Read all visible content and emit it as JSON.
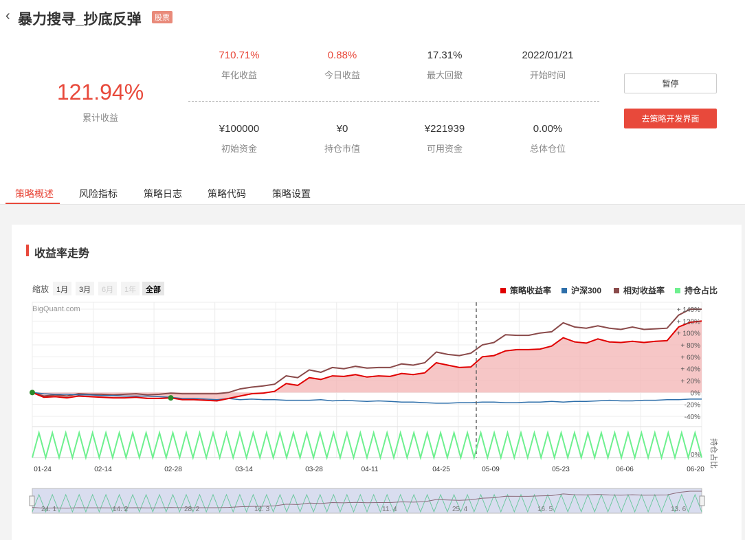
{
  "header": {
    "back_icon": "chevron-left-icon",
    "back_glyph": "‹",
    "title": "暴力搜寻_抄底反弹",
    "badge": "股票"
  },
  "summary": {
    "cumulative_value": "121.94%",
    "cumulative_label": "累计收益",
    "metrics": [
      {
        "value": "710.71%",
        "label": "年化收益",
        "color": "#e8493b"
      },
      {
        "value": "0.88%",
        "label": "今日收益",
        "color": "#e8493b"
      },
      {
        "value": "17.31%",
        "label": "最大回撤"
      },
      {
        "value": "2022/01/21",
        "label": "开始时间"
      },
      {
        "value": "¥100000",
        "label": "初始资金"
      },
      {
        "value": "¥0",
        "label": "持仓市值"
      },
      {
        "value": "¥221939",
        "label": "可用资金"
      },
      {
        "value": "0.00%",
        "label": "总体仓位"
      }
    ]
  },
  "actions": {
    "pause": "暂停",
    "dev": "去策略开发界面"
  },
  "tabs": [
    "策略概述",
    "风险指标",
    "策略日志",
    "策略代码",
    "策略设置"
  ],
  "section_title": "收益率走势",
  "zoom": {
    "label": "缩放",
    "options": [
      "1月",
      "3月",
      "6月",
      "1年",
      "全部"
    ],
    "disabled": [
      2,
      3
    ],
    "selected": 4
  },
  "legend": [
    {
      "label": "策略收益率",
      "color": "#e00000"
    },
    {
      "label": "沪深300",
      "color": "#2e6faa"
    },
    {
      "label": "相对收益率",
      "color": "#8a4a4a"
    },
    {
      "label": "持仓占比",
      "color": "#6ef08f"
    }
  ],
  "chart_data": {
    "type": "line",
    "watermark": "BigQuant.com",
    "x_ticks": [
      "01-24",
      "02-14",
      "02-28",
      "03-14",
      "03-28",
      "04-11",
      "04-25",
      "05-09",
      "05-23",
      "06-06",
      "06-20"
    ],
    "y_ticks": [
      "+ 140%",
      "+ 120%",
      "+ 100%",
      "+ 80%",
      "+ 60%",
      "+ 40%",
      "+ 20%",
      "0%",
      "-20%",
      "-40%"
    ],
    "ylim": [
      -40,
      140
    ],
    "position_axis_label": "持仓占比",
    "position_axis_tick": "0%",
    "navigator_labels": [
      "24. 1",
      "14. 2",
      "28. 2",
      "14. 3",
      "11. 4",
      "25. 4",
      "16. 5",
      "13. 6"
    ],
    "series": [
      {
        "name": "策略收益率",
        "color": "#e00000",
        "values": [
          0,
          -8,
          -7,
          -9,
          -6,
          -7,
          -8,
          -9,
          -9,
          -8,
          -10,
          -10,
          -9,
          -12,
          -12,
          -13,
          -14,
          -10,
          -6,
          -2,
          -1,
          2,
          15,
          12,
          25,
          22,
          28,
          27,
          30,
          26,
          28,
          27,
          32,
          30,
          33,
          50,
          46,
          42,
          43,
          60,
          62,
          70,
          72,
          72,
          73,
          78,
          92,
          85,
          83,
          90,
          85,
          84,
          86,
          84,
          86,
          87,
          110,
          118,
          120
        ],
        "markers": [
          0,
          12
        ]
      },
      {
        "name": "沪深300",
        "color": "#2e6faa",
        "values": [
          0,
          -2,
          -3,
          -3,
          -4,
          -4,
          -5,
          -5,
          -6,
          -6,
          -6,
          -7,
          -8,
          -10,
          -10,
          -11,
          -12,
          -10,
          -12,
          -11,
          -12,
          -12,
          -13,
          -13,
          -13,
          -12,
          -14,
          -13,
          -14,
          -15,
          -14,
          -15,
          -16,
          -16,
          -17,
          -18,
          -18,
          -17,
          -17,
          -16,
          -16,
          -17,
          -17,
          -16,
          -16,
          -15,
          -16,
          -15,
          -15,
          -14,
          -13,
          -14,
          -14,
          -13,
          -13,
          -12,
          -12,
          -11,
          -11
        ]
      },
      {
        "name": "相对收益率",
        "color": "#8a4a4a",
        "values": [
          0,
          -6,
          -4,
          -6,
          -2,
          -3,
          -3,
          -4,
          -3,
          -2,
          -4,
          -3,
          -1,
          -2,
          -2,
          -2,
          -2,
          0,
          6,
          9,
          11,
          14,
          28,
          25,
          38,
          34,
          42,
          40,
          44,
          41,
          42,
          42,
          48,
          46,
          50,
          68,
          64,
          62,
          66,
          80,
          84,
          97,
          96,
          96,
          100,
          102,
          117,
          110,
          108,
          112,
          108,
          106,
          110,
          106,
          107,
          108,
          130,
          140,
          140
        ]
      },
      {
        "name": "持仓占比",
        "color": "#6ef08f",
        "values": [
          0,
          100,
          0,
          100,
          0,
          100,
          0,
          100,
          0,
          100,
          0,
          100,
          0,
          100,
          0,
          100,
          0,
          100,
          0,
          100,
          0,
          100,
          0,
          100,
          0,
          100,
          0,
          100,
          0,
          100,
          0,
          100,
          0,
          100,
          0,
          100,
          0,
          100,
          0,
          100,
          0,
          100,
          0,
          100,
          0,
          100,
          0,
          100,
          0,
          100,
          0,
          100,
          0,
          100,
          0,
          100,
          0,
          100,
          0,
          100,
          0,
          100,
          0,
          100,
          0,
          100,
          0,
          100,
          0,
          100,
          0,
          100,
          0,
          100,
          0,
          100,
          0,
          100,
          0,
          100,
          0,
          100,
          0,
          100,
          0,
          100,
          0,
          100,
          0,
          100,
          0,
          100,
          0,
          100,
          0,
          100,
          0,
          100,
          0,
          100,
          0
        ]
      }
    ]
  }
}
